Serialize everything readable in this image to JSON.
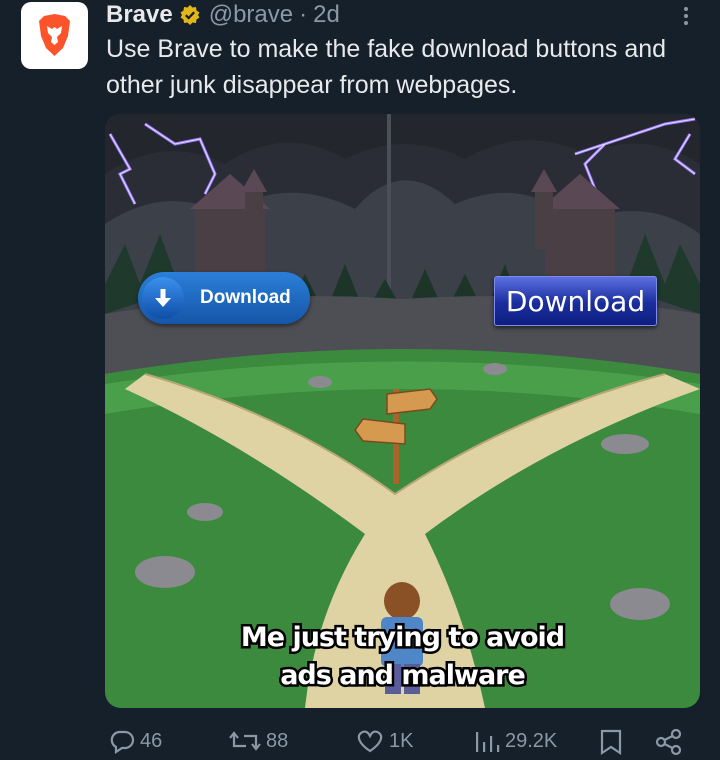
{
  "post": {
    "author_name": "Brave",
    "handle": "@brave",
    "separator": "·",
    "time": "2d",
    "text": "Use Brave to make the fake download buttons and other junk disappear from webpages.",
    "verified_icon": "verified-badge-icon",
    "more_icon": "more-vertical-icon"
  },
  "media": {
    "left_button_label": "Download",
    "right_button_label": "Download",
    "caption_line1": "Me just trying to avoid",
    "caption_line2": "ads and malware"
  },
  "actions": {
    "replies": "46",
    "reposts": "88",
    "likes": "1K",
    "views": "29.2K",
    "icons": [
      "reply-icon",
      "repost-icon",
      "like-icon",
      "views-icon",
      "bookmark-icon",
      "share-icon"
    ]
  },
  "colors": {
    "background": "#15202b",
    "brand_orange": "#fb542b",
    "secondary_text": "#8b98a5",
    "verified_gold": "#e2b719"
  }
}
